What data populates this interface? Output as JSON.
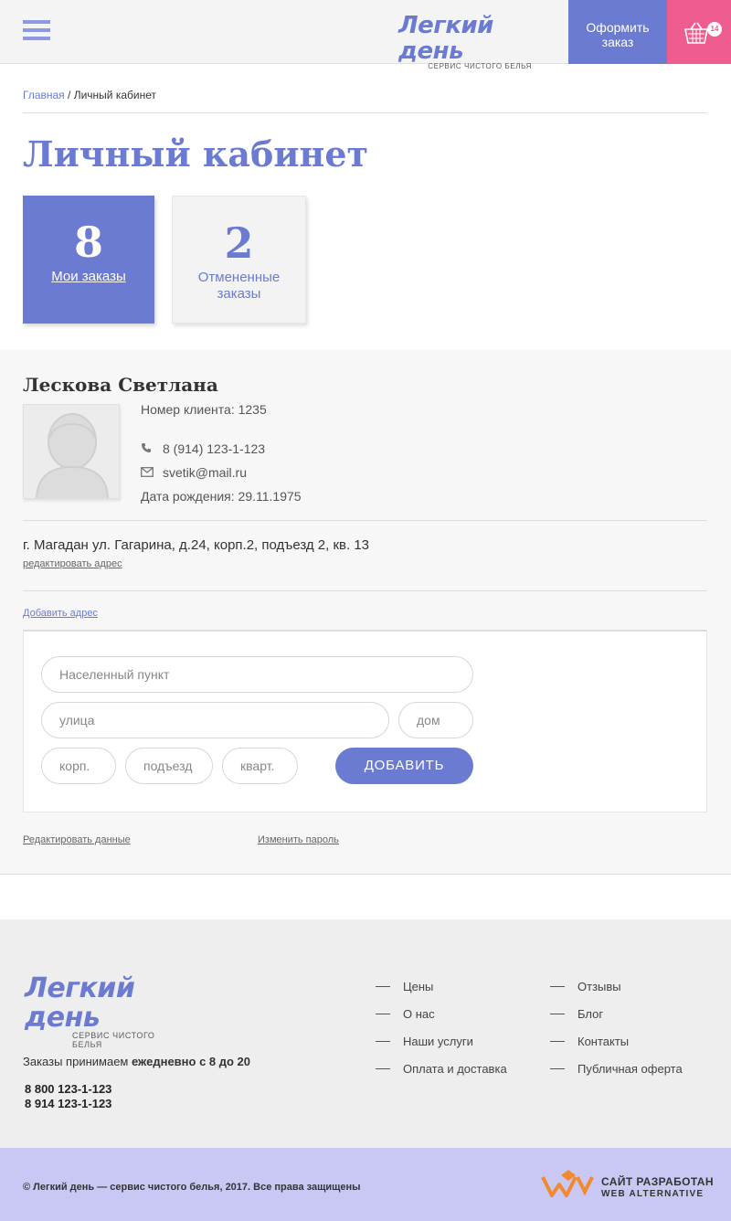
{
  "header": {
    "logo_title": "Легкий день",
    "logo_subtitle": "СЕРВИС ЧИСТОГО БЕЛЬЯ",
    "order_button": "Оформить заказ",
    "cart_count": "14",
    "accent_color": "#6b7bd1",
    "cart_color": "#ef5c8f"
  },
  "breadcrumb": {
    "home": "Главная",
    "separator": "/",
    "current": "Личный кабинет"
  },
  "page_title": "Личный кабинет",
  "stats": [
    {
      "value": "8",
      "label": "Мои заказы"
    },
    {
      "value": "2",
      "label": "Отмененные заказы"
    }
  ],
  "profile": {
    "name": "Лескова Светлана",
    "client_number": "Номер клиента: 1235",
    "phone": "8 (914) 123-1-123",
    "email": "svetik@mail.ru",
    "birthdate": "Дата рождения: 29.11.1975",
    "address": "г. Магадан ул. Гагарина, д.24, корп.2, подъезд 2, кв. 13",
    "edit_address": "редактировать адрес",
    "add_address": "Добавить адрес",
    "edit_data": "Редактировать данные",
    "change_password": "Изменить пароль"
  },
  "address_form": {
    "city_placeholder": "Населенный пункт",
    "street_placeholder": "улица",
    "house_placeholder": "дом",
    "building_placeholder": "корп.",
    "entrance_placeholder": "подъезд",
    "apartment_placeholder": "кварт.",
    "submit": "ДОБАВИТЬ"
  },
  "footer": {
    "logo_title": "Легкий день",
    "logo_subtitle": "СЕРВИС ЧИСТОГО БЕЛЬЯ",
    "orders_text": "Заказы  принимаем",
    "orders_hours": "ежедневно с 8 до 20",
    "phone1": "8 800 123-1-123",
    "phone2": "8 914  123-1-123",
    "menu_col1": [
      "Цены",
      "О нас",
      "Наши услуги",
      "Оплата и доставка"
    ],
    "menu_col2": [
      "Отзывы",
      "Блог",
      "Контакты",
      "Публичная оферта"
    ],
    "copyright": "© Легкий день — сервис чистого белья, 2017. Все права защищены",
    "dev_line1": "САЙТ РАЗРАБОТАН",
    "dev_line2": "WEB ALTERNATIVE",
    "bottom_bg": "#c9c8f5"
  },
  "icons": [
    "burger-menu-icon",
    "basket-icon",
    "phone-icon",
    "envelope-icon",
    "avatar-placeholder-icon",
    "web-alternative-logo-icon"
  ]
}
